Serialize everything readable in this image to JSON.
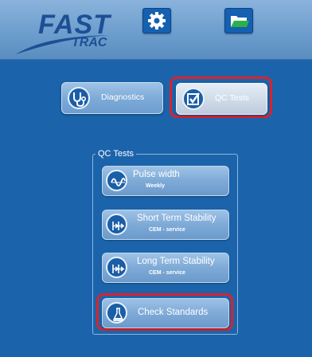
{
  "header": {
    "logo": {
      "word_top": "FAST",
      "word_bottom": "TRAC"
    },
    "icons": [
      "gear-icon",
      "folder-icon"
    ]
  },
  "modes": {
    "diagnostics": {
      "label": "Diagnostics",
      "icon": "stethoscope-icon"
    },
    "qc_tests": {
      "label": "QC Tests",
      "icon": "checkbox-icon",
      "selected": true
    }
  },
  "group": {
    "title": "QC Tests",
    "tests": [
      {
        "title": "Pulse width",
        "subtitle": "Weekly",
        "icon": "pulse-icon"
      },
      {
        "title": "Short Term Stability",
        "subtitle": "CEM - service",
        "icon": "stability-icon"
      },
      {
        "title": "Long Term Stability",
        "subtitle": "CEM - service",
        "icon": "stability-icon"
      },
      {
        "title": "Check Standards",
        "subtitle": "",
        "icon": "flask-icon",
        "highlighted": true
      }
    ]
  },
  "colors": {
    "background": "#1b64ab",
    "highlight": "#d8232f",
    "button": "#7eaad7"
  }
}
